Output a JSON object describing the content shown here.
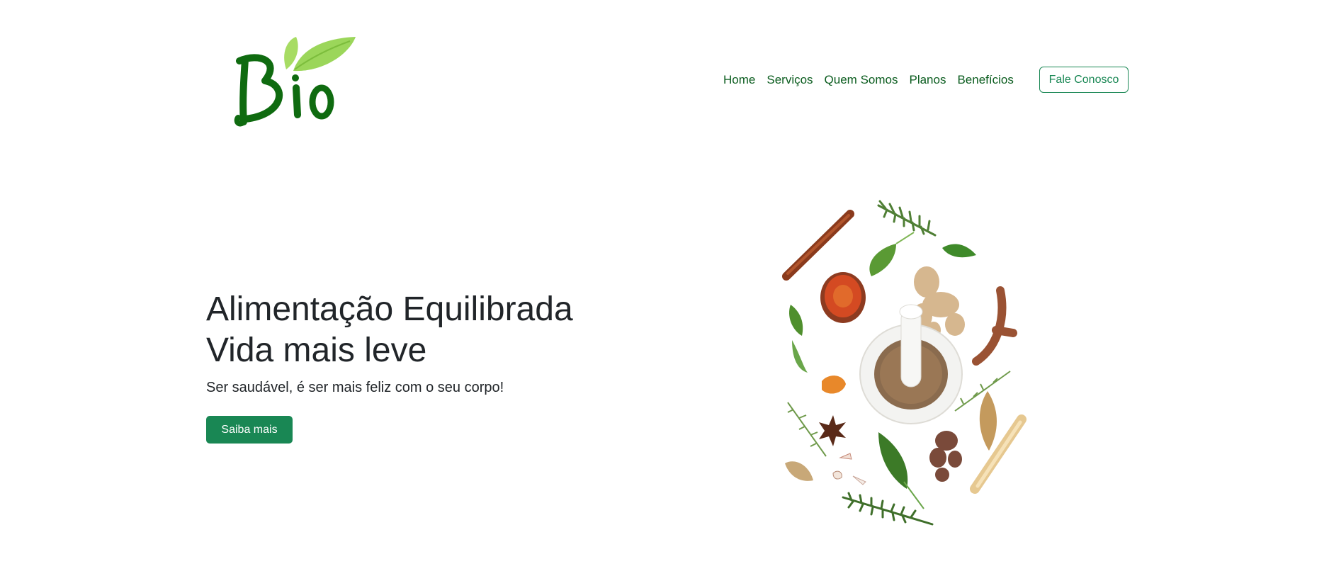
{
  "brand": {
    "logo_text": "Bio",
    "logo_color": "#0f6b10",
    "leaf_color": "#9bd65a"
  },
  "nav": {
    "items": [
      "Home",
      "Serviços",
      "Quem Somos",
      "Planos",
      "Benefícios"
    ],
    "contact_label": "Fale Conosco"
  },
  "hero": {
    "title_line1": "Alimentação Equilibrada",
    "title_line2": "Vida mais leve",
    "subtitle": "Ser saudável, é ser mais feliz com o seu corpo!",
    "cta_label": "Saiba mais"
  },
  "colors": {
    "accent": "#198754",
    "nav_text": "#0a5c1e",
    "text": "#212529"
  },
  "illustration": {
    "icon": "herbs-and-spices-mortar-icon"
  }
}
